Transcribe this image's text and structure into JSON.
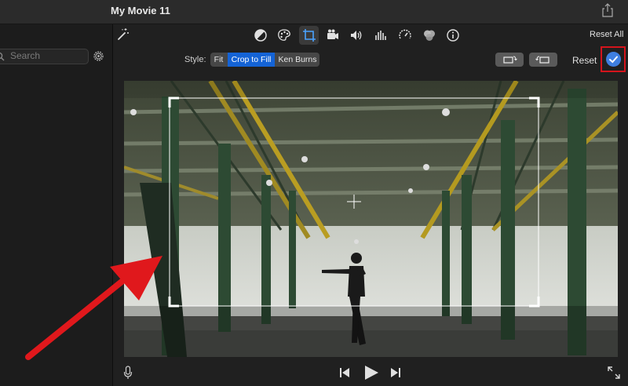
{
  "window": {
    "title": "My Movie 11"
  },
  "sidebar": {
    "search_placeholder": "Search"
  },
  "toolbar": {
    "icons": [
      "magic-wand-icon",
      "color-balance-icon",
      "color-correction-icon",
      "crop-icon",
      "stabilization-icon",
      "volume-icon",
      "noise-reduction-icon",
      "speed-icon",
      "clip-filter-icon",
      "info-icon"
    ],
    "active": "crop",
    "reset_all": "Reset All"
  },
  "crop_bar": {
    "style_label": "Style:",
    "options": [
      "Fit",
      "Crop to Fill",
      "Ken Burns"
    ],
    "selected": "Crop to Fill",
    "reset": "Reset"
  },
  "colors": {
    "accent": "#1463d6",
    "apply": "#3f7fe0",
    "highlight": "#d4141c",
    "arrow": "#e0181c"
  }
}
